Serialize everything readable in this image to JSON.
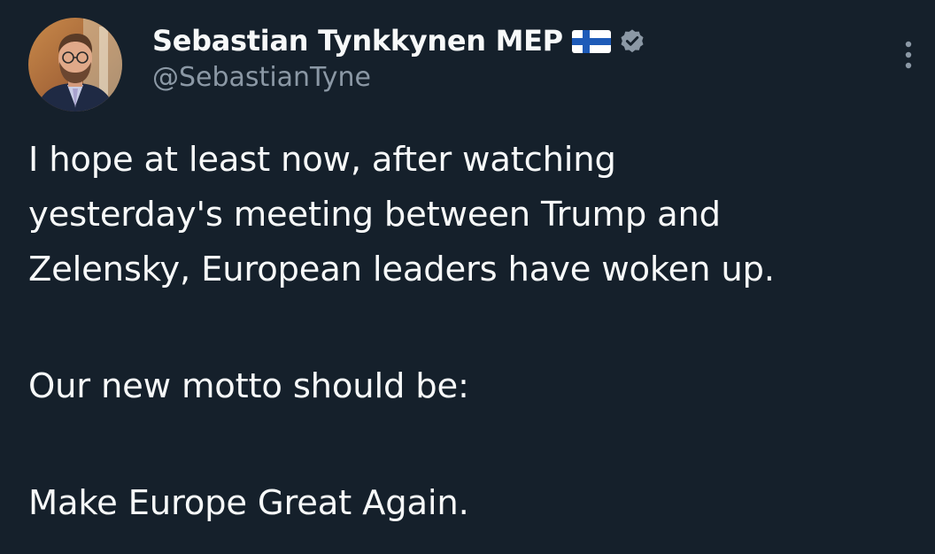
{
  "tweet": {
    "author": {
      "display_name": "Sebastian Tynkkynen MEP",
      "handle": "@SebastianTyne",
      "flag_icon": "finland-flag-emoji",
      "verified_icon": "verified-badge-icon",
      "verified_color": "#8b98a5"
    },
    "more_icon": "more-options-icon",
    "body": {
      "line1": "I hope at least now, after watching",
      "line2": "yesterday's meeting between Trump and",
      "line3": "Zelensky, European leaders have woken up.",
      "line4": "Our new motto should be:",
      "line5": "Make Europe Great Again."
    }
  },
  "theme": {
    "background": "#15202b",
    "text": "#f7f9f9",
    "secondary_text": "#8b98a5"
  }
}
